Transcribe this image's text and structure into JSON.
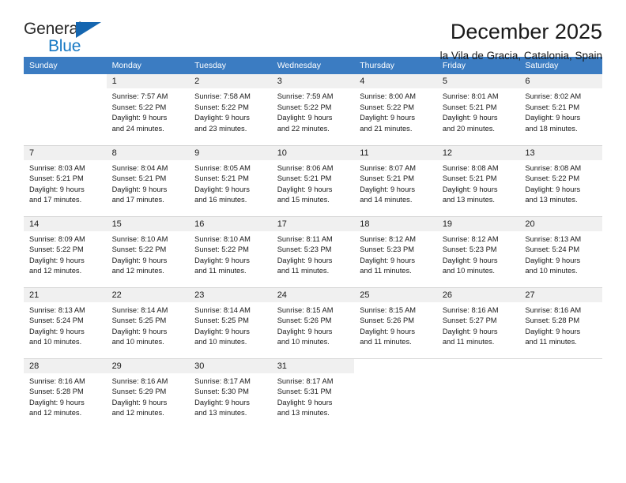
{
  "logo": {
    "primary_text": "General",
    "secondary_text": "Blue",
    "primary_color": "#2b2b2b",
    "secondary_color": "#1779c4",
    "triangle_color": "#1566b0"
  },
  "header": {
    "title": "December 2025",
    "subtitle": "la Vila de Gracia, Catalonia, Spain"
  },
  "theme": {
    "header_bg": "#3b7cc2",
    "header_text": "#ffffff",
    "daynum_bg": "#f0f0f0",
    "row_border": "#d5d5d5",
    "body_text": "#1a1a1a"
  },
  "calendar": {
    "weekday_headers": [
      "Sunday",
      "Monday",
      "Tuesday",
      "Wednesday",
      "Thursday",
      "Friday",
      "Saturday"
    ],
    "weeks": [
      [
        {
          "day": "",
          "empty": true,
          "sunrise": "",
          "sunset": "",
          "daylight_line1": "",
          "daylight_line2": ""
        },
        {
          "day": "1",
          "empty": false,
          "sunrise": "Sunrise: 7:57 AM",
          "sunset": "Sunset: 5:22 PM",
          "daylight_line1": "Daylight: 9 hours",
          "daylight_line2": "and 24 minutes."
        },
        {
          "day": "2",
          "empty": false,
          "sunrise": "Sunrise: 7:58 AM",
          "sunset": "Sunset: 5:22 PM",
          "daylight_line1": "Daylight: 9 hours",
          "daylight_line2": "and 23 minutes."
        },
        {
          "day": "3",
          "empty": false,
          "sunrise": "Sunrise: 7:59 AM",
          "sunset": "Sunset: 5:22 PM",
          "daylight_line1": "Daylight: 9 hours",
          "daylight_line2": "and 22 minutes."
        },
        {
          "day": "4",
          "empty": false,
          "sunrise": "Sunrise: 8:00 AM",
          "sunset": "Sunset: 5:22 PM",
          "daylight_line1": "Daylight: 9 hours",
          "daylight_line2": "and 21 minutes."
        },
        {
          "day": "5",
          "empty": false,
          "sunrise": "Sunrise: 8:01 AM",
          "sunset": "Sunset: 5:21 PM",
          "daylight_line1": "Daylight: 9 hours",
          "daylight_line2": "and 20 minutes."
        },
        {
          "day": "6",
          "empty": false,
          "sunrise": "Sunrise: 8:02 AM",
          "sunset": "Sunset: 5:21 PM",
          "daylight_line1": "Daylight: 9 hours",
          "daylight_line2": "and 18 minutes."
        }
      ],
      [
        {
          "day": "7",
          "empty": false,
          "sunrise": "Sunrise: 8:03 AM",
          "sunset": "Sunset: 5:21 PM",
          "daylight_line1": "Daylight: 9 hours",
          "daylight_line2": "and 17 minutes."
        },
        {
          "day": "8",
          "empty": false,
          "sunrise": "Sunrise: 8:04 AM",
          "sunset": "Sunset: 5:21 PM",
          "daylight_line1": "Daylight: 9 hours",
          "daylight_line2": "and 17 minutes."
        },
        {
          "day": "9",
          "empty": false,
          "sunrise": "Sunrise: 8:05 AM",
          "sunset": "Sunset: 5:21 PM",
          "daylight_line1": "Daylight: 9 hours",
          "daylight_line2": "and 16 minutes."
        },
        {
          "day": "10",
          "empty": false,
          "sunrise": "Sunrise: 8:06 AM",
          "sunset": "Sunset: 5:21 PM",
          "daylight_line1": "Daylight: 9 hours",
          "daylight_line2": "and 15 minutes."
        },
        {
          "day": "11",
          "empty": false,
          "sunrise": "Sunrise: 8:07 AM",
          "sunset": "Sunset: 5:21 PM",
          "daylight_line1": "Daylight: 9 hours",
          "daylight_line2": "and 14 minutes."
        },
        {
          "day": "12",
          "empty": false,
          "sunrise": "Sunrise: 8:08 AM",
          "sunset": "Sunset: 5:21 PM",
          "daylight_line1": "Daylight: 9 hours",
          "daylight_line2": "and 13 minutes."
        },
        {
          "day": "13",
          "empty": false,
          "sunrise": "Sunrise: 8:08 AM",
          "sunset": "Sunset: 5:22 PM",
          "daylight_line1": "Daylight: 9 hours",
          "daylight_line2": "and 13 minutes."
        }
      ],
      [
        {
          "day": "14",
          "empty": false,
          "sunrise": "Sunrise: 8:09 AM",
          "sunset": "Sunset: 5:22 PM",
          "daylight_line1": "Daylight: 9 hours",
          "daylight_line2": "and 12 minutes."
        },
        {
          "day": "15",
          "empty": false,
          "sunrise": "Sunrise: 8:10 AM",
          "sunset": "Sunset: 5:22 PM",
          "daylight_line1": "Daylight: 9 hours",
          "daylight_line2": "and 12 minutes."
        },
        {
          "day": "16",
          "empty": false,
          "sunrise": "Sunrise: 8:10 AM",
          "sunset": "Sunset: 5:22 PM",
          "daylight_line1": "Daylight: 9 hours",
          "daylight_line2": "and 11 minutes."
        },
        {
          "day": "17",
          "empty": false,
          "sunrise": "Sunrise: 8:11 AM",
          "sunset": "Sunset: 5:23 PM",
          "daylight_line1": "Daylight: 9 hours",
          "daylight_line2": "and 11 minutes."
        },
        {
          "day": "18",
          "empty": false,
          "sunrise": "Sunrise: 8:12 AM",
          "sunset": "Sunset: 5:23 PM",
          "daylight_line1": "Daylight: 9 hours",
          "daylight_line2": "and 11 minutes."
        },
        {
          "day": "19",
          "empty": false,
          "sunrise": "Sunrise: 8:12 AM",
          "sunset": "Sunset: 5:23 PM",
          "daylight_line1": "Daylight: 9 hours",
          "daylight_line2": "and 10 minutes."
        },
        {
          "day": "20",
          "empty": false,
          "sunrise": "Sunrise: 8:13 AM",
          "sunset": "Sunset: 5:24 PM",
          "daylight_line1": "Daylight: 9 hours",
          "daylight_line2": "and 10 minutes."
        }
      ],
      [
        {
          "day": "21",
          "empty": false,
          "sunrise": "Sunrise: 8:13 AM",
          "sunset": "Sunset: 5:24 PM",
          "daylight_line1": "Daylight: 9 hours",
          "daylight_line2": "and 10 minutes."
        },
        {
          "day": "22",
          "empty": false,
          "sunrise": "Sunrise: 8:14 AM",
          "sunset": "Sunset: 5:25 PM",
          "daylight_line1": "Daylight: 9 hours",
          "daylight_line2": "and 10 minutes."
        },
        {
          "day": "23",
          "empty": false,
          "sunrise": "Sunrise: 8:14 AM",
          "sunset": "Sunset: 5:25 PM",
          "daylight_line1": "Daylight: 9 hours",
          "daylight_line2": "and 10 minutes."
        },
        {
          "day": "24",
          "empty": false,
          "sunrise": "Sunrise: 8:15 AM",
          "sunset": "Sunset: 5:26 PM",
          "daylight_line1": "Daylight: 9 hours",
          "daylight_line2": "and 10 minutes."
        },
        {
          "day": "25",
          "empty": false,
          "sunrise": "Sunrise: 8:15 AM",
          "sunset": "Sunset: 5:26 PM",
          "daylight_line1": "Daylight: 9 hours",
          "daylight_line2": "and 11 minutes."
        },
        {
          "day": "26",
          "empty": false,
          "sunrise": "Sunrise: 8:16 AM",
          "sunset": "Sunset: 5:27 PM",
          "daylight_line1": "Daylight: 9 hours",
          "daylight_line2": "and 11 minutes."
        },
        {
          "day": "27",
          "empty": false,
          "sunrise": "Sunrise: 8:16 AM",
          "sunset": "Sunset: 5:28 PM",
          "daylight_line1": "Daylight: 9 hours",
          "daylight_line2": "and 11 minutes."
        }
      ],
      [
        {
          "day": "28",
          "empty": false,
          "sunrise": "Sunrise: 8:16 AM",
          "sunset": "Sunset: 5:28 PM",
          "daylight_line1": "Daylight: 9 hours",
          "daylight_line2": "and 12 minutes."
        },
        {
          "day": "29",
          "empty": false,
          "sunrise": "Sunrise: 8:16 AM",
          "sunset": "Sunset: 5:29 PM",
          "daylight_line1": "Daylight: 9 hours",
          "daylight_line2": "and 12 minutes."
        },
        {
          "day": "30",
          "empty": false,
          "sunrise": "Sunrise: 8:17 AM",
          "sunset": "Sunset: 5:30 PM",
          "daylight_line1": "Daylight: 9 hours",
          "daylight_line2": "and 13 minutes."
        },
        {
          "day": "31",
          "empty": false,
          "sunrise": "Sunrise: 8:17 AM",
          "sunset": "Sunset: 5:31 PM",
          "daylight_line1": "Daylight: 9 hours",
          "daylight_line2": "and 13 minutes."
        },
        {
          "day": "",
          "empty": true,
          "sunrise": "",
          "sunset": "",
          "daylight_line1": "",
          "daylight_line2": ""
        },
        {
          "day": "",
          "empty": true,
          "sunrise": "",
          "sunset": "",
          "daylight_line1": "",
          "daylight_line2": ""
        },
        {
          "day": "",
          "empty": true,
          "sunrise": "",
          "sunset": "",
          "daylight_line1": "",
          "daylight_line2": ""
        }
      ]
    ]
  }
}
